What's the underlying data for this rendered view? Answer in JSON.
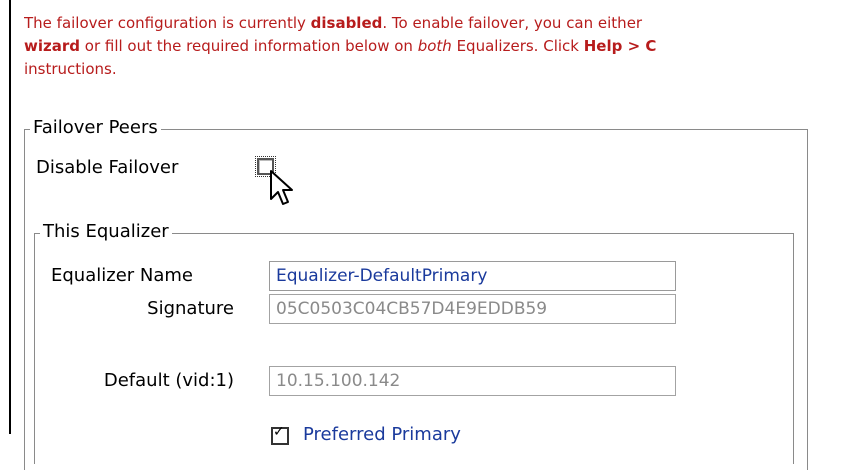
{
  "notice": {
    "line1_a": "The failover configuration is currently ",
    "line1_b": "disabled",
    "line1_c": ". To enable failover, you can either",
    "line2_a": "wizard",
    "line2_b": " or fill out the required information below on ",
    "line2_c": "both",
    "line2_d": " Equalizers. Click ",
    "line2_e": "Help > C",
    "line3": "instructions."
  },
  "failover_peers": {
    "legend": "Failover Peers",
    "disable_label": "Disable Failover",
    "disable_checked": false
  },
  "this_equalizer": {
    "legend": "This Equalizer",
    "name_label": "Equalizer Name",
    "name_value": "Equalizer-DefaultPrimary",
    "signature_label": "Signature",
    "signature_value": "05C0503C04CB57D4E9EDDB59",
    "default_label": "Default (vid:1)",
    "default_value": "10.15.100.142",
    "preferred_label": "Preferred Primary",
    "preferred_checked": true
  },
  "colors": {
    "notice": "#b71c1c",
    "field_text": "#1a3a9c",
    "readonly_text": "#8a8a8a"
  }
}
